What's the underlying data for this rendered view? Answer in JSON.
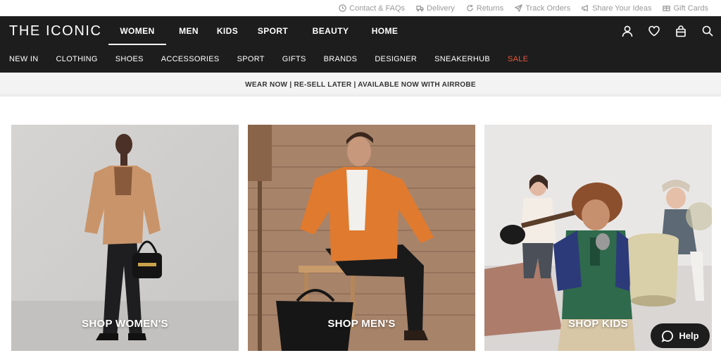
{
  "utility_links": [
    {
      "label": "Contact & FAQs",
      "icon": "clock-icon"
    },
    {
      "label": "Delivery",
      "icon": "truck-icon"
    },
    {
      "label": "Returns",
      "icon": "returns-icon"
    },
    {
      "label": "Track Orders",
      "icon": "send-icon"
    },
    {
      "label": "Share Your Ideas",
      "icon": "megaphone-icon"
    },
    {
      "label": "Gift Cards",
      "icon": "gift-card-icon"
    }
  ],
  "header": {
    "logo": "THE ICONIC",
    "main_nav": [
      "WOMEN",
      "MEN",
      "KIDS",
      "SPORT",
      "BEAUTY",
      "HOME"
    ],
    "active_nav": "WOMEN",
    "categories": [
      "NEW IN",
      "CLOTHING",
      "SHOES",
      "ACCESSORIES",
      "SPORT",
      "GIFTS",
      "BRANDS",
      "DESIGNER",
      "SNEAKERHUB",
      "SALE"
    ],
    "sale_color": "#e8573a"
  },
  "promo": {
    "text": "WEAR NOW | RE-SELL LATER | AVAILABLE NOW WITH AIRROBE"
  },
  "tiles": [
    {
      "label": "SHOP WOMEN'S"
    },
    {
      "label": "SHOP MEN'S"
    },
    {
      "label": "SHOP KIDS"
    }
  ],
  "help": {
    "label": "Help"
  }
}
